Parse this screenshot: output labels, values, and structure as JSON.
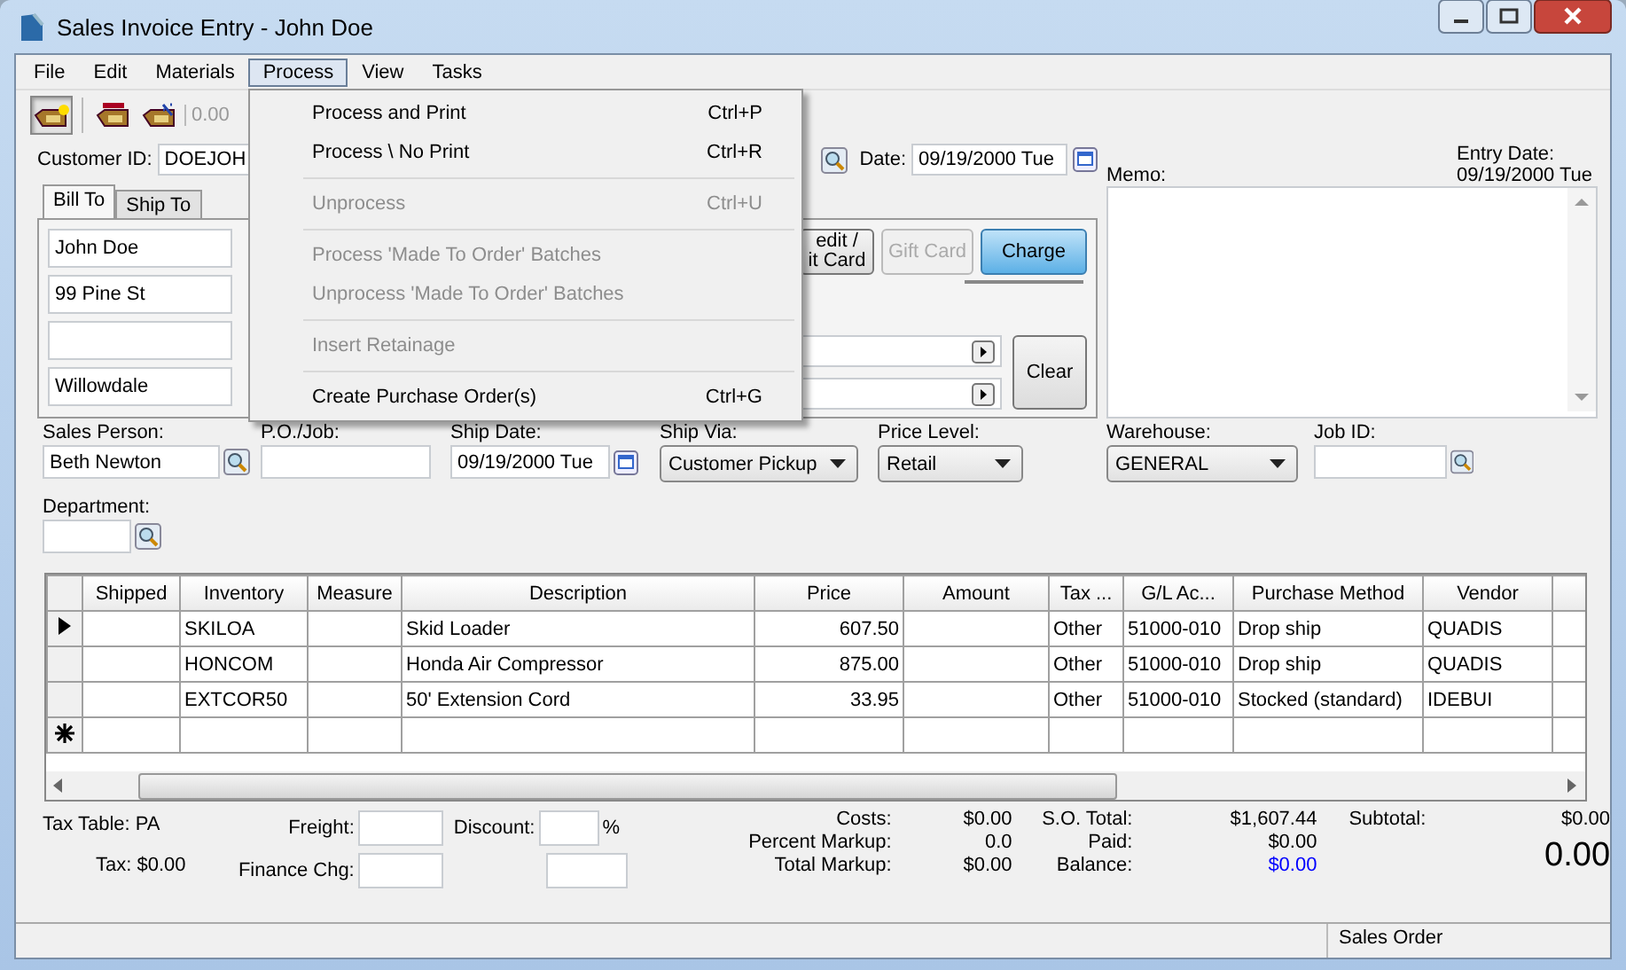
{
  "window": {
    "title": "Sales Invoice Entry - John Doe"
  },
  "menu_bar": [
    {
      "label": "File",
      "selected": false
    },
    {
      "label": "Edit",
      "selected": false
    },
    {
      "label": "Materials",
      "selected": false
    },
    {
      "label": "Process",
      "selected": true
    },
    {
      "label": "View",
      "selected": false
    },
    {
      "label": "Tasks",
      "selected": false
    }
  ],
  "open_menu": [
    {
      "kind": "item",
      "label": "Process and Print",
      "shortcut": "Ctrl+P",
      "disabled": false
    },
    {
      "kind": "item",
      "label": "Process \\ No Print",
      "shortcut": "Ctrl+R",
      "disabled": false
    },
    {
      "kind": "separator"
    },
    {
      "kind": "item",
      "label": "Unprocess",
      "shortcut": "Ctrl+U",
      "disabled": true
    },
    {
      "kind": "separator"
    },
    {
      "kind": "item",
      "label": "Process 'Made To Order' Batches",
      "disabled": true
    },
    {
      "kind": "item",
      "label": "Unprocess 'Made To Order' Batches",
      "disabled": true
    },
    {
      "kind": "separator"
    },
    {
      "kind": "item",
      "label": "Insert Retainage",
      "disabled": true
    },
    {
      "kind": "separator"
    },
    {
      "kind": "item",
      "label": "Create Purchase Order(s)",
      "shortcut": "Ctrl+G",
      "disabled": false
    }
  ],
  "toolbar": {
    "buttons": [
      {
        "kind": "new-tag",
        "selected": true
      },
      {
        "kind": "level-tag",
        "selected": false
      },
      {
        "kind": "percent-tag",
        "selected": false
      }
    ],
    "reading": "0.00"
  },
  "customer": {
    "label": "Customer ID:",
    "value": "DOEJOH"
  },
  "date": {
    "label": "Date:",
    "value": "09/19/2000 Tue"
  },
  "memo": {
    "label": "Memo:"
  },
  "entry_date": {
    "label": "Entry Date:",
    "value": "09/19/2000 Tue"
  },
  "address_tabs": [
    {
      "label": "Bill To",
      "selected": true
    },
    {
      "label": "Ship To",
      "selected": false
    }
  ],
  "address_fields": [
    {
      "kind": "text",
      "value": "John Doe"
    },
    {
      "kind": "text",
      "value": "99 Pine St"
    },
    {
      "kind": "blank"
    },
    {
      "kind": "text",
      "value": "Willowdale"
    }
  ],
  "payment_buttons": [
    {
      "label": "edit /\nit Card",
      "disabled": false,
      "selected": false
    },
    {
      "label": "Gift Card",
      "disabled": true,
      "selected": false
    },
    {
      "label": "Charge",
      "disabled": false,
      "selected": true
    }
  ],
  "clear_button": "Clear",
  "order_fields": [
    {
      "kind": "lookup",
      "label": "Sales Person:",
      "value": "Beth Newton"
    },
    {
      "kind": "text",
      "label": "P.O./Job:"
    },
    {
      "kind": "date",
      "label": "Ship Date:",
      "value": "09/19/2000 Tue"
    },
    {
      "kind": "dropdown",
      "label": "Ship Via:",
      "value": "Customer Pickup"
    },
    {
      "kind": "dropdown",
      "label": "Price Level:",
      "value": "Retail"
    },
    {
      "kind": "dropdown",
      "label": "Warehouse:",
      "value": "GENERAL"
    },
    {
      "kind": "lookup",
      "label": "Job ID:"
    }
  ],
  "department": {
    "label": "Department:"
  },
  "table": {
    "columns": [
      "Shipped",
      "Inventory",
      "Measure",
      "Description",
      "Price",
      "Amount",
      "Tax ...",
      "G/L Ac...",
      "Purchase Method",
      "Vendor"
    ],
    "rows": [
      {
        "kind": "current",
        "cells": [
          "",
          "SKILOA",
          "",
          "Skid Loader",
          "607.50",
          "",
          "Other",
          "51000-010",
          "Drop ship",
          "QUADIS"
        ]
      },
      {
        "kind": "plain",
        "cells": [
          "",
          "HONCOM",
          "",
          "Honda Air Compressor",
          "875.00",
          "",
          "Other",
          "51000-010",
          "Drop ship",
          "QUADIS"
        ]
      },
      {
        "kind": "plain",
        "cells": [
          "",
          "EXTCOR50",
          "",
          "50' Extension Cord",
          "33.95",
          "",
          "Other",
          "51000-010",
          "Stocked (standard)",
          "IDEBUI"
        ]
      },
      {
        "kind": "new",
        "cells": [
          "",
          "",
          "",
          "",
          "",
          "",
          "",
          "",
          "",
          ""
        ]
      }
    ]
  },
  "footer": {
    "tax_table": "Tax Table: PA",
    "tax": "Tax: $0.00",
    "freight_label": "Freight:",
    "finance_label": "Finance Chg:",
    "discount_label": "Discount:",
    "percent_sign": "%",
    "costs": [
      {
        "label": "Costs:",
        "value": "$0.00"
      },
      {
        "label": "Percent Markup:",
        "value": "0.0"
      },
      {
        "label": "Total Markup:",
        "value": "$0.00"
      }
    ],
    "totals": [
      {
        "label": "S.O. Total:",
        "value": "$1,607.44",
        "highlight": false
      },
      {
        "label": "Paid:",
        "value": "$0.00",
        "highlight": false
      },
      {
        "label": "Balance:",
        "value": "$0.00",
        "highlight": true
      }
    ],
    "subtotal_label": "Subtotal:",
    "subtotal_value": "$0.00",
    "grand_total": "0.00"
  },
  "status_bar": {
    "text": "Sales Order"
  }
}
